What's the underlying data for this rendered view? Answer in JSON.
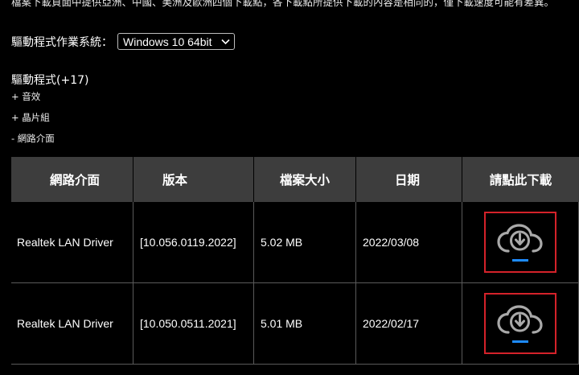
{
  "notice": "檔案下載頁面中提供亞洲、中國、美洲及歐洲四個下載點，各下載點所提供下載的內容是相同的，僅下載速度可能有差異。",
  "os": {
    "label": "驅動程式作業系統：",
    "selected": "Windows 10 64bit"
  },
  "drivers": {
    "title": "驅動程式(+17)",
    "categories": [
      "+ 音效",
      "+ 晶片組",
      "- 網路介面"
    ]
  },
  "table": {
    "headers": [
      "網路介面",
      "版本",
      "檔案大小",
      "日期",
      "請點此下載"
    ],
    "rows": [
      {
        "name": "Realtek LAN Driver",
        "version": "[10.056.0119.2022]",
        "size": "5.02 MB",
        "date": "2022/03/08"
      },
      {
        "name": "Realtek LAN Driver",
        "version": "[10.050.0511.2021]",
        "size": "5.01 MB",
        "date": "2022/02/17"
      }
    ]
  },
  "colors": {
    "highlight_border": "#d4222a",
    "icon_accent": "#1e8bff",
    "header_bg": "#3d3d3d"
  },
  "icons": {
    "download": "cloud-download-icon",
    "dropdown": "chevron-down-icon"
  }
}
